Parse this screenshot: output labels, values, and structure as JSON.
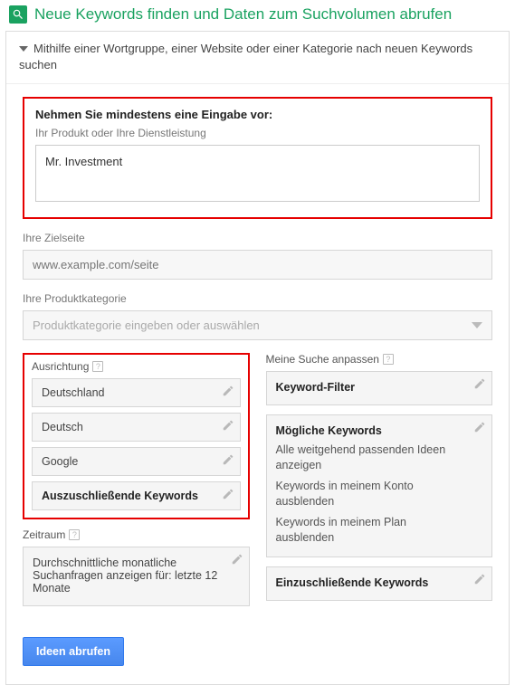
{
  "header": {
    "title": "Neue Keywords finden und Daten zum Suchvolumen abrufen"
  },
  "accordion": {
    "label": "Mithilfe einer Wortgruppe, einer Website oder einer Kategorie nach neuen Keywords suchen"
  },
  "main_input": {
    "heading": "Nehmen Sie mindestens eine Eingabe vor:",
    "sublabel": "Ihr Produkt oder Ihre Dienstleistung",
    "value": "Mr. Investment"
  },
  "landing_page": {
    "label": "Ihre Zielseite",
    "placeholder": "www.example.com/seite"
  },
  "category": {
    "label": "Ihre Produktkategorie",
    "placeholder": "Produktkategorie eingeben oder auswählen"
  },
  "targeting": {
    "title": "Ausrichtung",
    "items": [
      "Deutschland",
      "Deutsch",
      "Google"
    ],
    "negative": "Auszuschließende Keywords"
  },
  "date_range": {
    "title": "Zeitraum",
    "text": "Durchschnittliche monatliche Suchanfragen anzeigen für: letzte 12 Monate"
  },
  "customize": {
    "title": "Meine Suche anpassen",
    "filter": "Keyword-Filter",
    "possible": {
      "title": "Mögliche Keywords",
      "lines": [
        "Alle weitgehend passenden Ideen anzeigen",
        "Keywords in meinem Konto ausblenden",
        "Keywords in meinem Plan ausblenden"
      ]
    },
    "include": "Einzuschließende Keywords"
  },
  "submit": {
    "label": "Ideen abrufen"
  }
}
